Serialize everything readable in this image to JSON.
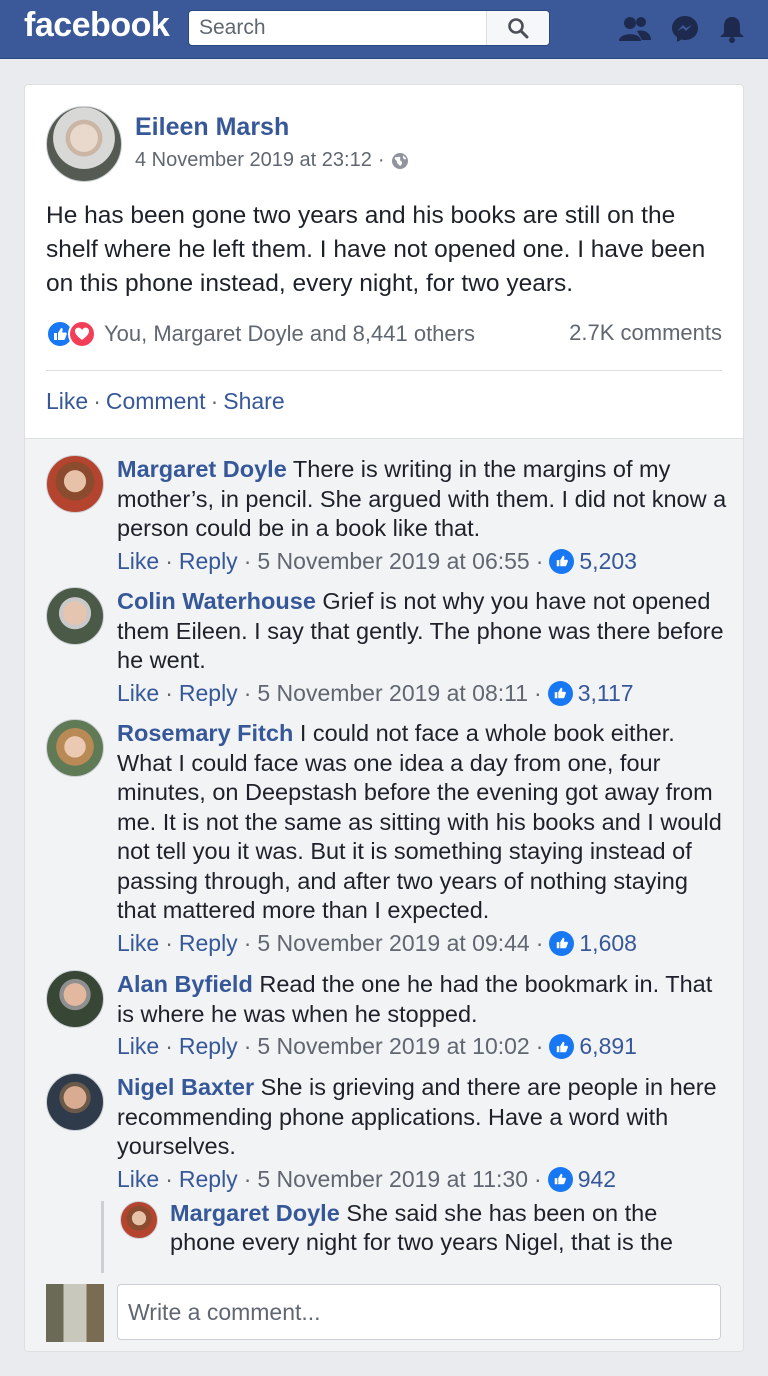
{
  "header": {
    "logo": "facebook",
    "search_placeholder": "Search",
    "icons": [
      "friends-icon",
      "messenger-icon",
      "notifications-icon"
    ]
  },
  "colors": {
    "brand": "#3b5998",
    "link": "#365899",
    "like_blue": "#1877f2",
    "love_red": "#f33e58",
    "background": "#e9ebee"
  },
  "post": {
    "author": "Eileen Marsh",
    "timestamp": "4 November 2019 at 23:12",
    "meta_sep": "·",
    "privacy_icon": "globe-icon",
    "text": "He has been gone two years and his books are still on the shelf where he left them. I have not opened one. I have been on this phone instead, every night, for two years.",
    "reactions_text": "You, Margaret Doyle and 8,441 others",
    "comments_count": "2.7K comments",
    "actions": {
      "like": "Like",
      "comment": "Comment",
      "share": "Share",
      "sep": "·"
    }
  },
  "comment_actions": {
    "like": "Like",
    "reply": "Reply",
    "sep": "·"
  },
  "comments": [
    {
      "name": "Margaret Doyle",
      "text": "There is writing in the margins of my mother’s, in pencil. She argued with them. I did not know a person could be in a book like that.",
      "time": "5 November 2019 at 06:55",
      "likes": "5,203"
    },
    {
      "name": "Colin Waterhouse",
      "text": "Grief is not why you have not opened them Eileen. I say that gently. The phone was there before he went.",
      "time": "5 November 2019 at 08:11",
      "likes": "3,117"
    },
    {
      "name": "Rosemary Fitch",
      "text": "I could not face a whole book either. What I could face was one idea a day from one, four minutes, on Deepstash before the evening got away from me. It is not the same as sitting with his books and I would not tell you it was. But it is something staying instead of passing through, and after two years of nothing staying that mattered more than I expected.",
      "time": "5 November 2019 at 09:44",
      "likes": "1,608"
    },
    {
      "name": "Alan Byfield",
      "text": "Read the one he had the bookmark in. That is where he was when he stopped.",
      "time": "5 November 2019 at 10:02",
      "likes": "6,891"
    },
    {
      "name": "Nigel Baxter",
      "text": "She is grieving and there are people in here recommending phone applications. Have a word with yourselves.",
      "time": "5 November 2019 at 11:30",
      "likes": "942"
    }
  ],
  "reply": {
    "name": "Margaret Doyle",
    "text": "She said she has been on the phone every night for two years Nigel, that is the"
  },
  "write_comment": {
    "placeholder": "Write a comment..."
  }
}
